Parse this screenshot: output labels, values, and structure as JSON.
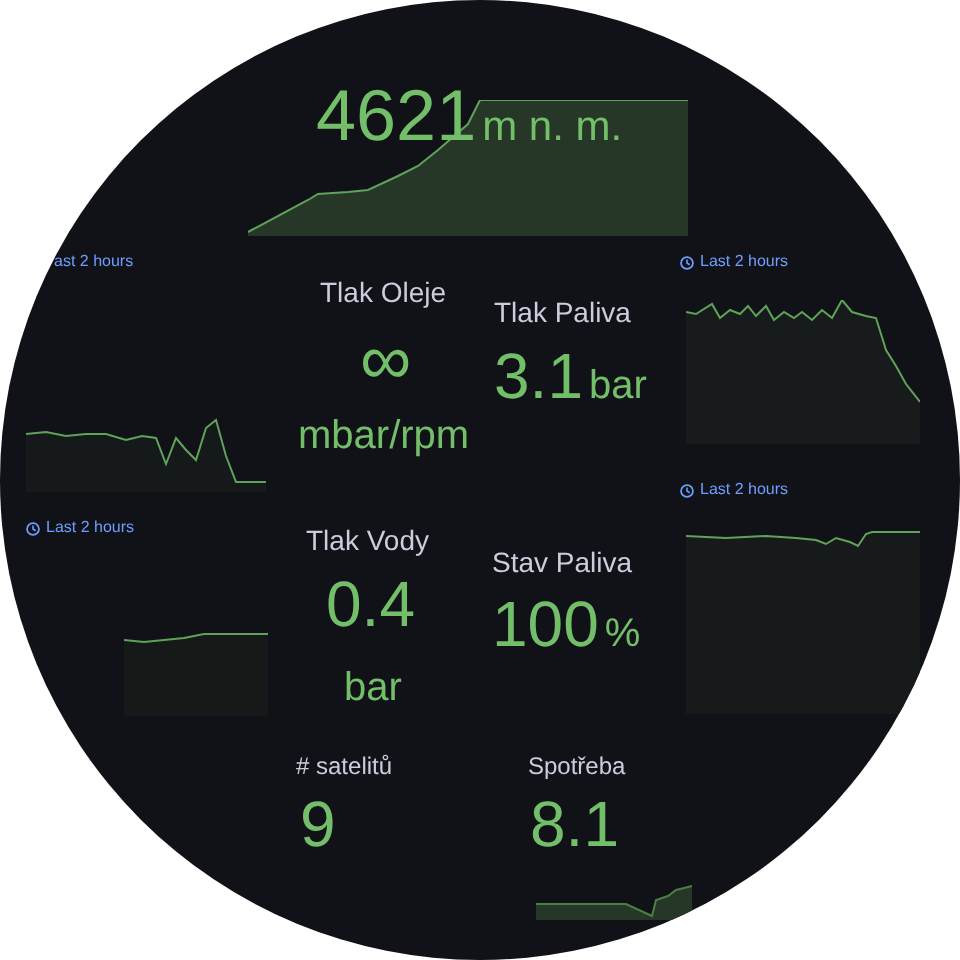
{
  "altitude": {
    "value": "4621",
    "unit": "m n. m."
  },
  "time_panels": [
    {
      "time_range": "ast 2 hours",
      "icon": false
    },
    {
      "time_range": "Last 2 hours",
      "icon": true
    },
    {
      "time_range": "Last 2 hours",
      "icon": true
    },
    {
      "time_range": "Last 2 hours",
      "icon": true
    }
  ],
  "stats": [
    {
      "label": "Tlak Oleje",
      "value": "∞",
      "unit": "mbar/rpm"
    },
    {
      "label": "Tlak Paliva",
      "value": "3.1",
      "unit": "bar"
    },
    {
      "label": "Tlak Vody",
      "value": "0.4",
      "unit": "bar"
    },
    {
      "label": "Stav Paliva",
      "value": "100",
      "unit": "%"
    },
    {
      "label": "# satelitů",
      "value": "9"
    },
    {
      "label": "Spotřeba",
      "value": "8.1"
    }
  ]
}
